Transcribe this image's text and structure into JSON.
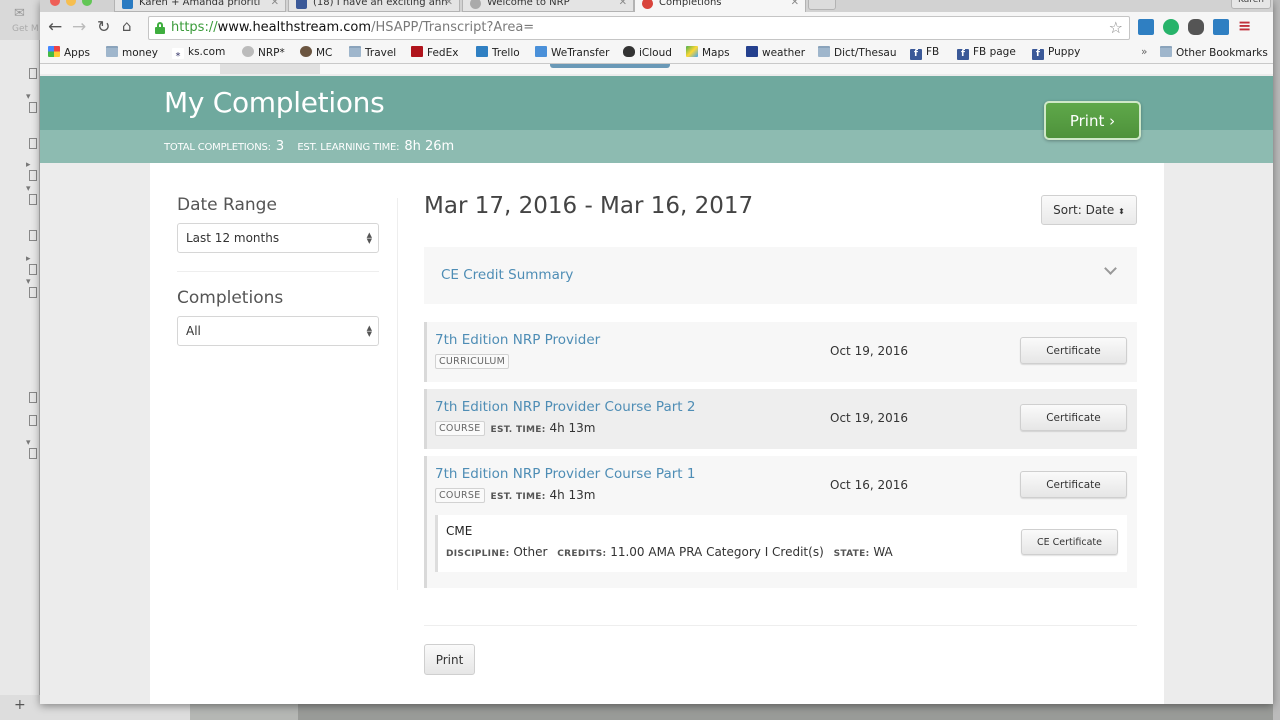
{
  "browser": {
    "tabs": [
      {
        "title": "Karen + Amanda prioriti",
        "icon": "trello-icon",
        "active": false
      },
      {
        "title": "(18) I have an exciting ann",
        "icon": "facebook-icon",
        "active": false
      },
      {
        "title": "Welcome to NRP",
        "icon": "nrp-icon",
        "active": false
      },
      {
        "title": "Completions",
        "icon": "healthstream-icon",
        "active": true
      }
    ],
    "profile": "Karen",
    "url": {
      "scheme": "https://",
      "host": "www.healthstream.com",
      "path": "/HSAPP/Transcript?Area="
    },
    "bookmarks": [
      {
        "label": "Apps",
        "icon": "apps-grid-icon"
      },
      {
        "label": "money",
        "icon": "folder-icon"
      },
      {
        "label": "ks.com",
        "icon": "ks-icon"
      },
      {
        "label": "NRP*",
        "icon": "nrp-icon"
      },
      {
        "label": "MC",
        "icon": "mailchimp-icon"
      },
      {
        "label": "Travel",
        "icon": "folder-icon"
      },
      {
        "label": "FedEx",
        "icon": "fedex-icon"
      },
      {
        "label": "Trello",
        "icon": "trello-icon"
      },
      {
        "label": "WeTransfer",
        "icon": "wetransfer-icon"
      },
      {
        "label": "iCloud",
        "icon": "apple-icon"
      },
      {
        "label": "Maps",
        "icon": "maps-icon"
      },
      {
        "label": "weather",
        "icon": "weather-icon"
      },
      {
        "label": "Dict/Thesau",
        "icon": "folder-icon"
      },
      {
        "label": "FB",
        "icon": "facebook-icon"
      },
      {
        "label": "FB page",
        "icon": "facebook-icon"
      },
      {
        "label": "Puppy",
        "icon": "facebook-icon"
      }
    ],
    "overflow": "»",
    "other_bookmarks": "Other Bookmarks"
  },
  "header": {
    "title": "My Completions",
    "total_completions_label": "TOTAL COMPLETIONS:",
    "total_completions_value": "3",
    "learning_time_label": "EST. LEARNING TIME:",
    "learning_time_value": "8h 26m",
    "print_label": "Print ›"
  },
  "filters": {
    "date_range_label": "Date Range",
    "date_range_value": "Last 12 months",
    "completions_label": "Completions",
    "completions_value": "All"
  },
  "main": {
    "range_title": "Mar 17, 2016 - Mar 16, 2017",
    "sort_label": "Sort: Date",
    "ce_summary_label": "CE Credit Summary",
    "items": [
      {
        "name": "7th Edition NRP Provider",
        "type": "CURRICULUM",
        "date": "Oct 19, 2016",
        "certificate_label": "Certificate"
      },
      {
        "name": "7th Edition NRP Provider Course Part 2",
        "type": "COURSE",
        "est_time_label": "EST. TIME:",
        "est_time": "4h 13m",
        "date": "Oct 19, 2016",
        "certificate_label": "Certificate"
      },
      {
        "name": "7th Edition NRP Provider Course Part 1",
        "type": "COURSE",
        "est_time_label": "EST. TIME:",
        "est_time": "4h 13m",
        "date": "Oct 16, 2016",
        "certificate_label": "Certificate",
        "cme": {
          "title": "CME",
          "discipline_label": "DISCIPLINE:",
          "discipline": "Other",
          "credits_label": "CREDITS:",
          "credits": "11.00 AMA PRA Category I Credit(s)",
          "state_label": "STATE:",
          "state": "WA",
          "ce_certificate_label": "CE Certificate"
        }
      }
    ],
    "print_label": "Print"
  },
  "colors": {
    "hero": "#6fa99e",
    "hero_sub": "#8dbbb1",
    "print_green": "#5fa84a",
    "link_blue": "#4e8db5"
  }
}
